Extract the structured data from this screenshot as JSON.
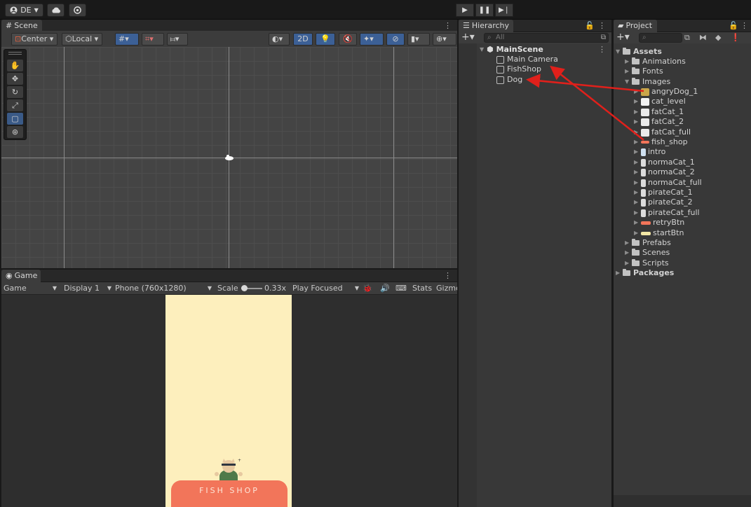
{
  "toolbar": {
    "account_label": "DE",
    "account_icon": "account-icon",
    "cloud_icon": "cloud-icon",
    "collab_icon": "collab-icon",
    "play_icon": "play-icon",
    "pause_icon": "pause-icon",
    "step_icon": "step-icon"
  },
  "scene": {
    "tab_label": "Scene",
    "pivot_label": "Center",
    "space_label": "Local",
    "mode_2d_label": "2D"
  },
  "game": {
    "tab_label": "Game",
    "view_select": "Game",
    "display_select": "Display 1",
    "resolution_select": "Phone (760x1280)",
    "scale_label": "Scale",
    "scale_value": "0.33x",
    "play_mode_select": "Play Focused",
    "stats_label": "Stats",
    "gizmos_label": "Gizmo",
    "shop_sign_text": "FISH SHOP"
  },
  "hierarchy": {
    "tab_label": "Hierarchy",
    "search_placeholder": "All",
    "scene_name": "MainScene",
    "items": [
      "Main Camera",
      "FishShop",
      "Dog"
    ]
  },
  "project": {
    "tab_label": "Project",
    "assets_label": "Assets",
    "folders_top": [
      "Animations",
      "Fonts"
    ],
    "images_label": "Images",
    "images": [
      "angryDog_1",
      "cat_level",
      "fatCat_1",
      "fatCat_2",
      "fatCat_full",
      "fish_shop",
      "intro",
      "normaCat_1",
      "normaCat_2",
      "normaCat_full",
      "pirateCat_1",
      "pirateCat_2",
      "pirateCat_full",
      "retryBtn",
      "startBtn"
    ],
    "folders_bottom": [
      "Prefabs",
      "Scenes",
      "Scripts"
    ],
    "packages_label": "Packages"
  },
  "colors": {
    "annotation_arrow": "#e0201b",
    "selection_blue": "#3a5a87",
    "game_background": "#fdefbd",
    "shop_awning": "#f2755a"
  }
}
